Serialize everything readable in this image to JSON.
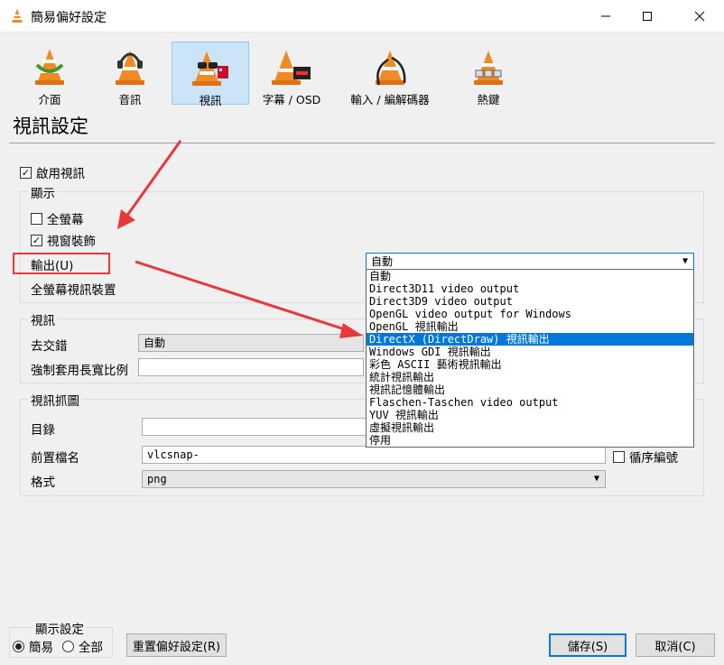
{
  "window": {
    "title": "簡易偏好設定"
  },
  "categories": [
    {
      "label": "介面",
      "icon": "vlc-cone-icon"
    },
    {
      "label": "音訊",
      "icon": "vlc-cone-headphones-icon"
    },
    {
      "label": "視訊",
      "icon": "vlc-cone-glasses-icon",
      "active": true
    },
    {
      "label": "字幕 / OSD",
      "icon": "vlc-cone-subtitle-icon"
    },
    {
      "label": "輸入 / 編解碼器",
      "icon": "vlc-cone-cables-icon"
    },
    {
      "label": "熱鍵",
      "icon": "vlc-cone-keys-icon"
    }
  ],
  "section_title": "視訊設定",
  "enable_video": {
    "label": "啟用視訊",
    "checked": true
  },
  "display": {
    "group_label": "顯示",
    "fullscreen": {
      "label": "全螢幕",
      "checked": false
    },
    "window_decorations": {
      "label": "視窗裝飾",
      "checked": true
    },
    "output_label": "輸出(U)",
    "output_value": "自動",
    "fullscreen_device_label": "全螢幕視訊裝置"
  },
  "video": {
    "group_label": "視訊",
    "deinterlace_label": "去交錯",
    "deinterlace_value": "自動",
    "aspect_label": "強制套用長寬比例",
    "aspect_value": ""
  },
  "snapshot": {
    "group_label": "視訊抓圖",
    "directory_label": "目錄",
    "directory_value": "",
    "prefix_label": "前置檔名",
    "prefix_value": "vlcsnap-",
    "sequential_label": "循序編號",
    "sequential_checked": false,
    "format_label": "格式",
    "format_value": "png"
  },
  "dropdown_options": [
    "自動",
    "Direct3D11 video output",
    "Direct3D9 video output",
    "OpenGL video output for Windows",
    "OpenGL 視訊輸出",
    "DirectX (DirectDraw) 視訊輸出",
    "Windows GDI 視訊輸出",
    "彩色 ASCII 藝術視訊輸出",
    "統計視訊輸出",
    "視訊記憶體輸出",
    "Flaschen-Taschen video output",
    "YUV 視訊輸出",
    "虛擬視訊輸出",
    "停用"
  ],
  "dropdown_selected_index": 5,
  "show_settings": {
    "group_label": "顯示設定",
    "simple": "簡易",
    "all": "全部",
    "selected": "簡易"
  },
  "buttons": {
    "reset": "重置偏好設定(R)",
    "save": "儲存(S)",
    "cancel": "取消(C)"
  },
  "annotation_color": "#e8383d",
  "accent_color": "#0078d7"
}
